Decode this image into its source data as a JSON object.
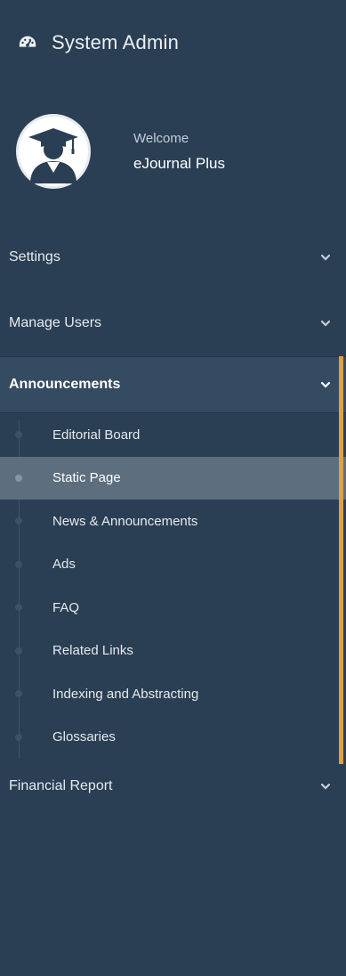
{
  "brand": {
    "icon": "dashboard-gauge-icon",
    "title": "System Admin"
  },
  "profile": {
    "avatar_icon": "graduate-avatar-icon",
    "welcome": "Welcome",
    "name": "eJournal Plus"
  },
  "menu": {
    "settings": "Settings",
    "manage_users": "Manage Users",
    "announcements": "Announcements",
    "financial_report": "Financial Report"
  },
  "submenu": [
    "Editorial Board",
    "Static Page",
    "News & Announcements",
    "Ads",
    "FAQ",
    "Related Links",
    "Indexing and Abstracting",
    "Glossaries"
  ],
  "colors": {
    "sidebar_bg": "#2a3f54",
    "active_bg": "#344b61",
    "current_sub_bg": "#5d6e7f",
    "accent": "#e0a04a"
  }
}
